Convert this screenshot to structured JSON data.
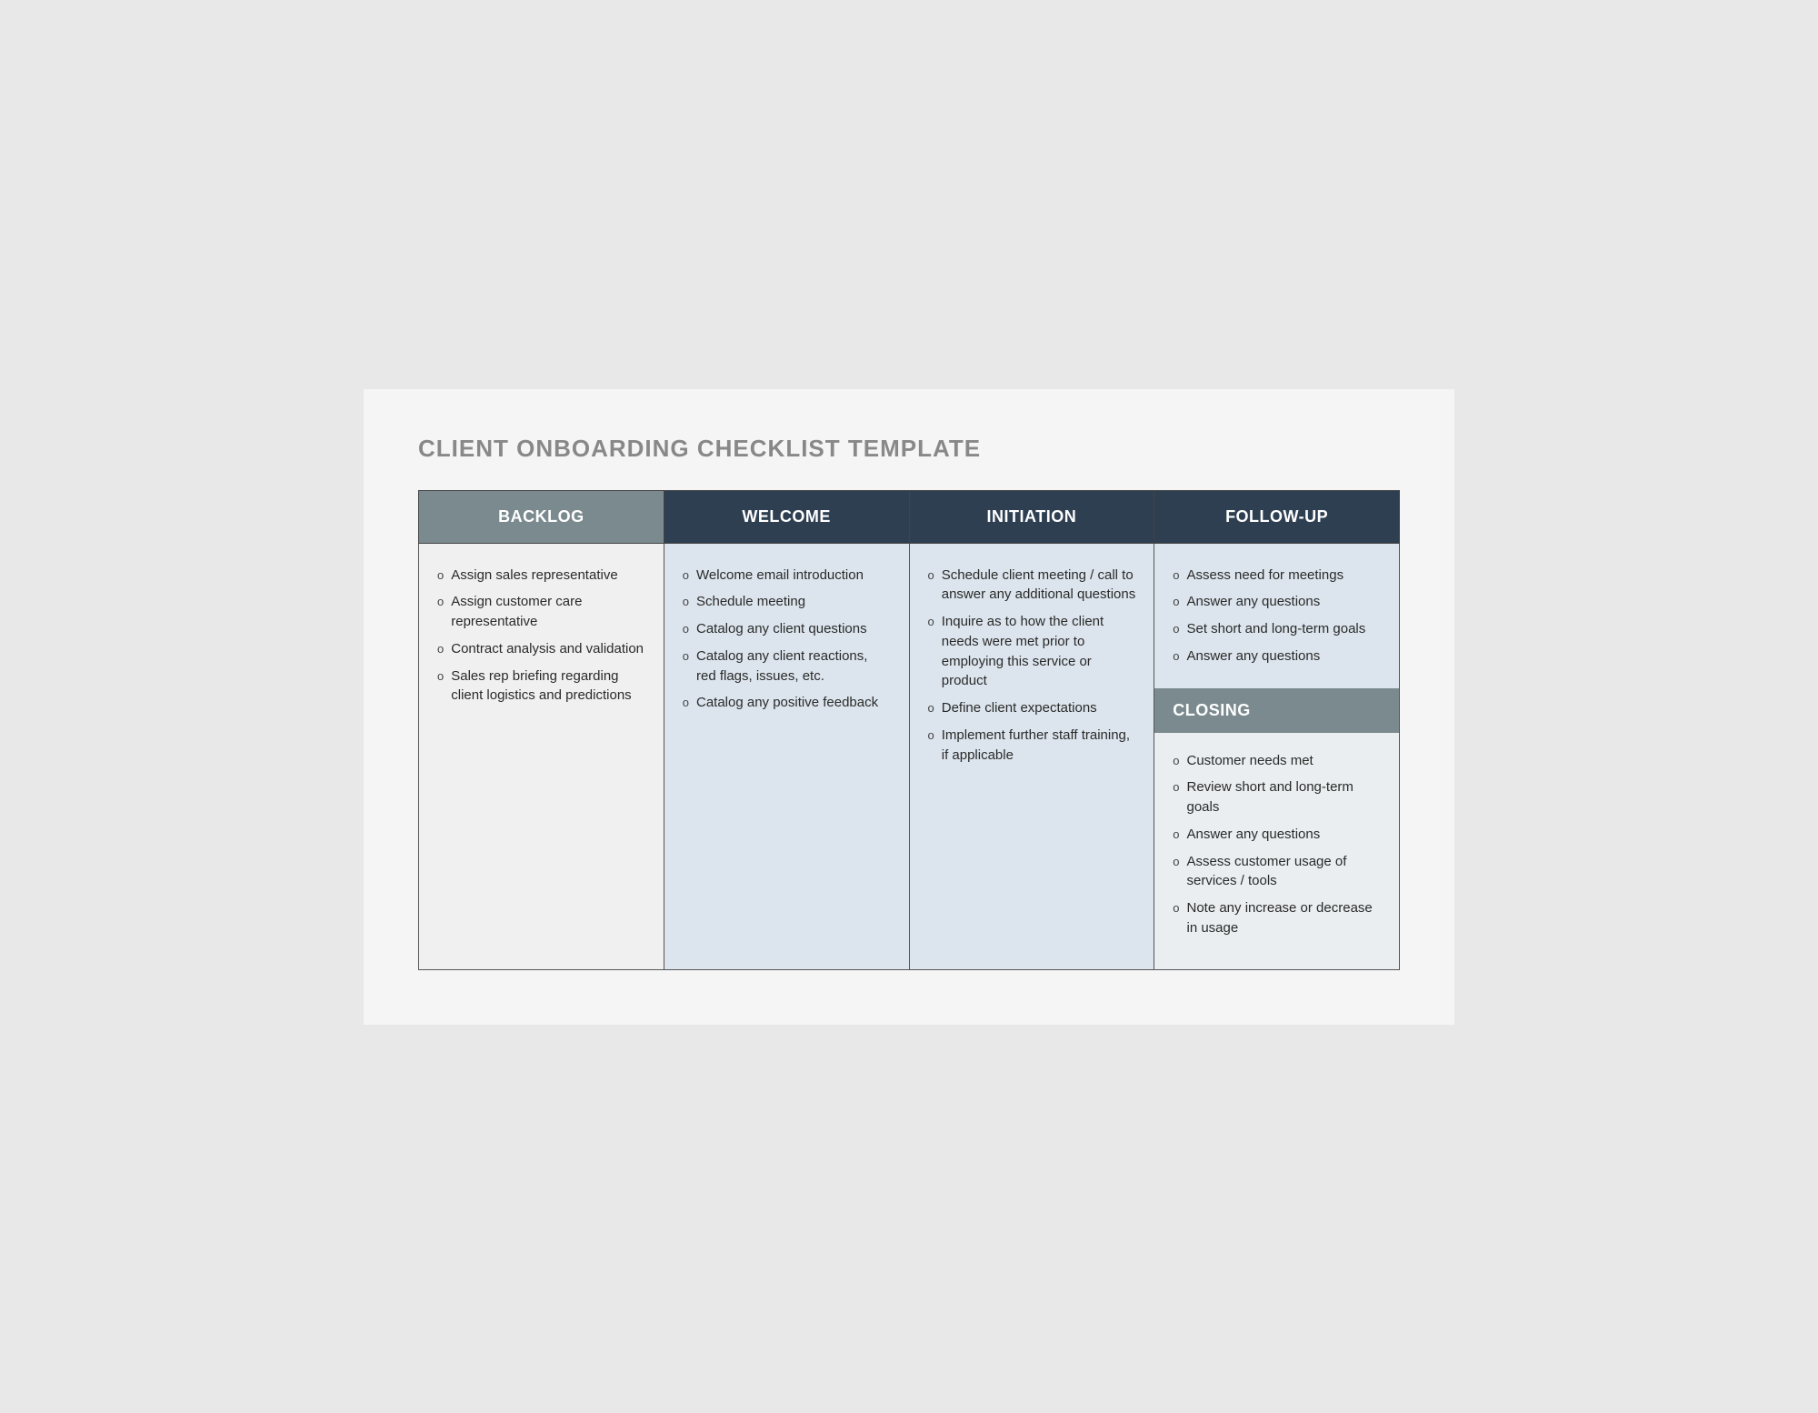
{
  "title": "CLIENT ONBOARDING CHECKLIST TEMPLATE",
  "columns": {
    "backlog": {
      "header": "BACKLOG",
      "items": [
        "Assign sales representative",
        "Assign customer care representative",
        "Contract analysis and validation",
        "Sales rep briefing regarding client logistics and predictions"
      ]
    },
    "welcome": {
      "header": "WELCOME",
      "items": [
        "Welcome email introduction",
        "Schedule meeting",
        "Catalog any client questions",
        "Catalog any client reactions, red flags, issues, etc.",
        "Catalog any positive feedback"
      ]
    },
    "initiation": {
      "header": "INITIATION",
      "items": [
        "Schedule client meeting / call to answer any additional questions",
        "Inquire as to how the client needs were met prior to employing this service or product",
        "Define client expectations",
        "Implement further staff training, if applicable"
      ]
    },
    "follow_up": {
      "header": "FOLLOW-UP",
      "items": [
        "Assess need for meetings",
        "Answer any questions",
        "Set short and long-term goals",
        "Answer any questions"
      ]
    },
    "closing": {
      "header": "CLOSING",
      "items": [
        "Customer needs met",
        "Review short and long-term goals",
        "Answer any questions",
        "Assess customer usage of services / tools",
        "Note any increase or decrease in usage"
      ]
    }
  }
}
